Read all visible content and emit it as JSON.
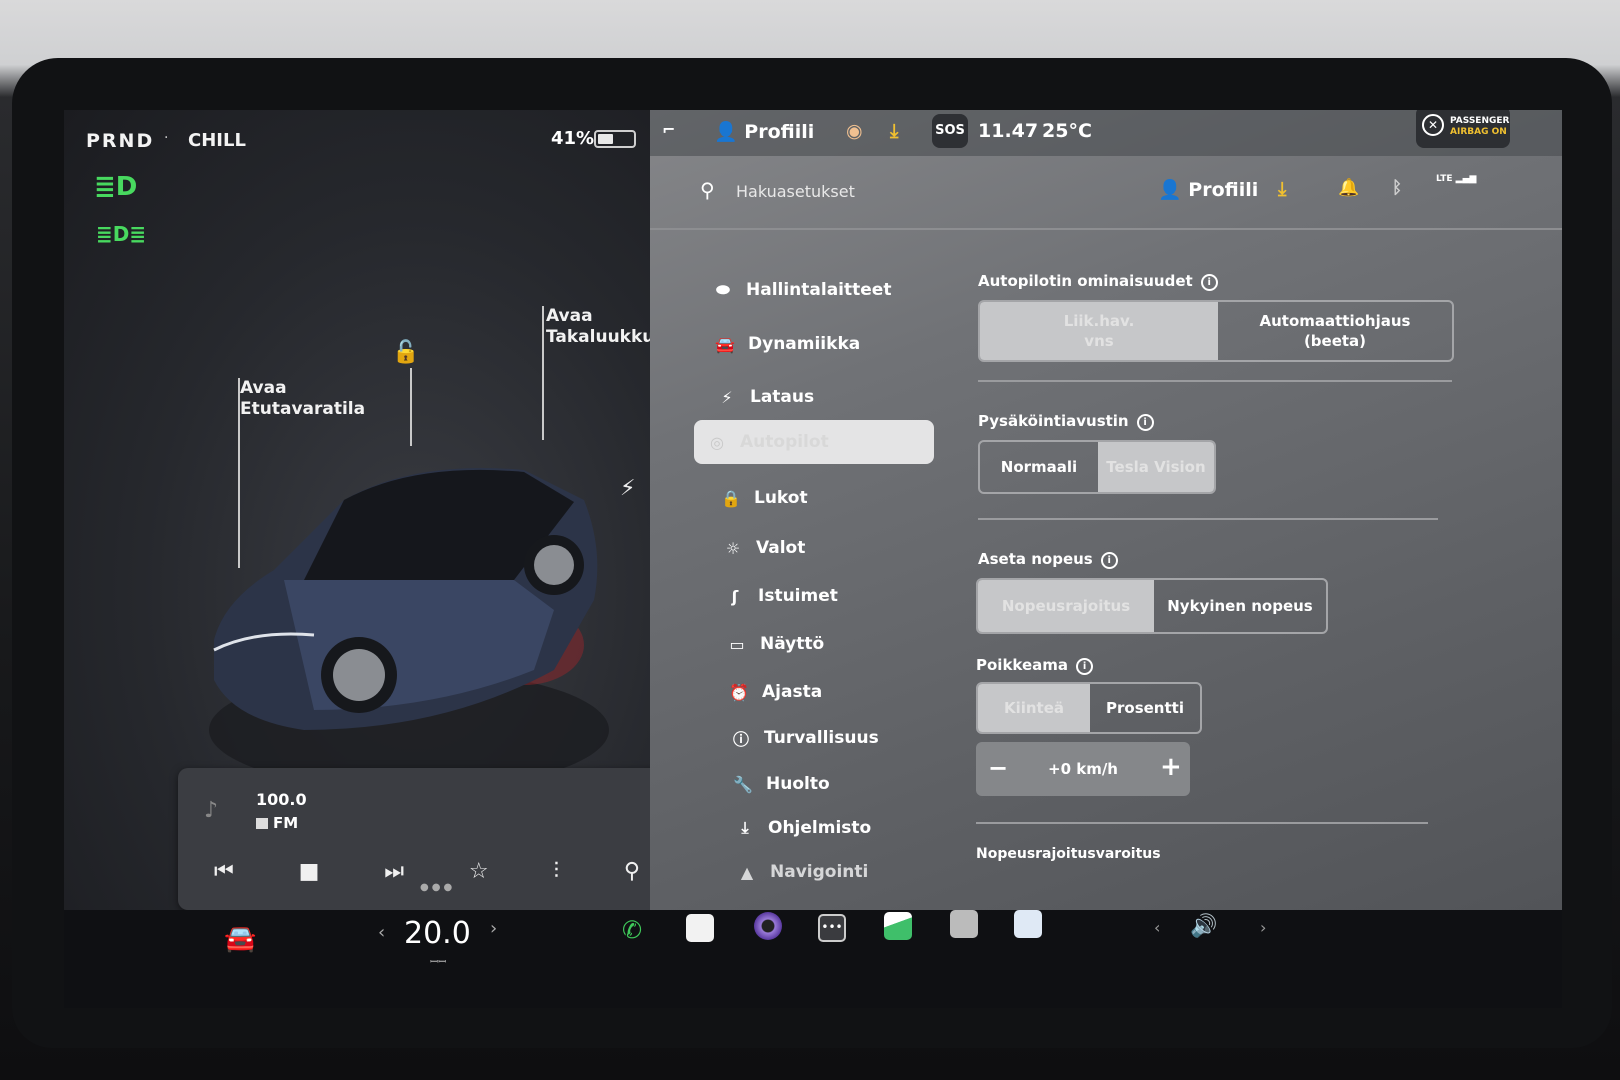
{
  "status": {
    "gear": "PRND",
    "drive_mode": "CHILL",
    "battery": "41%",
    "battery_level_pct": 41
  },
  "indicators": [
    "headlight-icon",
    "fog-light-icon"
  ],
  "car_view": {
    "frunk_label_1": "Avaa",
    "frunk_label_2": "Etutavaratila",
    "trunk_label_1": "Avaa",
    "trunk_label_2": "Takaluukku"
  },
  "media": {
    "frequency": "100.0",
    "band": "FM"
  },
  "topbar": {
    "profile": "Profiili",
    "sos": "SOS",
    "time": "11.47",
    "temperature": "25°C",
    "airbag_1": "PASSENGER",
    "airbag_2": "AIRBAG ON"
  },
  "search": {
    "placeholder": "Hakuasetukset",
    "profile": "Profiili",
    "network": "LTE"
  },
  "menu": [
    {
      "label": "Hallintalaitteet",
      "icon": "toggle-icon"
    },
    {
      "label": "Dynamiikka",
      "icon": "car-icon"
    },
    {
      "label": "Lataus",
      "icon": "bolt-icon"
    },
    {
      "label": "Autopilot",
      "icon": "steering-wheel-icon"
    },
    {
      "label": "Lukot",
      "icon": "lock-icon"
    },
    {
      "label": "Valot",
      "icon": "sun-icon"
    },
    {
      "label": "Istuimet",
      "icon": "seat-icon"
    },
    {
      "label": "Näyttö",
      "icon": "display-icon"
    },
    {
      "label": "Ajasta",
      "icon": "alarm-clock-icon"
    },
    {
      "label": "Turvallisuus",
      "icon": "warning-icon"
    },
    {
      "label": "Huolto",
      "icon": "wrench-icon"
    },
    {
      "label": "Ohjelmisto",
      "icon": "download-icon"
    },
    {
      "label": "Navigointi",
      "icon": "navigation-icon"
    }
  ],
  "autopilot": {
    "features_title": "Autopilotin ominaisuudet",
    "features_opt1_1": "Liik.hav.",
    "features_opt1_2": "vns",
    "features_opt2_1": "Automaattiohjaus",
    "features_opt2_2": "(beeta)",
    "park_title": "Pysäköintiavustin",
    "park_opt1": "Normaali",
    "park_opt2": "Tesla Vision",
    "speed_title": "Aseta nopeus",
    "speed_opt1": "Nopeusrajoitus",
    "speed_opt2": "Nykyinen nopeus",
    "offset_title": "Poikkeama",
    "offset_opt1": "Kiinteä",
    "offset_opt2": "Prosentti",
    "offset_value": "+0 km/h",
    "warning_title": "Nopeusrajoitusvaroitus"
  },
  "bottombar": {
    "temperature": "20.0"
  },
  "colors": {
    "indicator_green": "#48d95f",
    "download_yellow": "#f0c030"
  }
}
